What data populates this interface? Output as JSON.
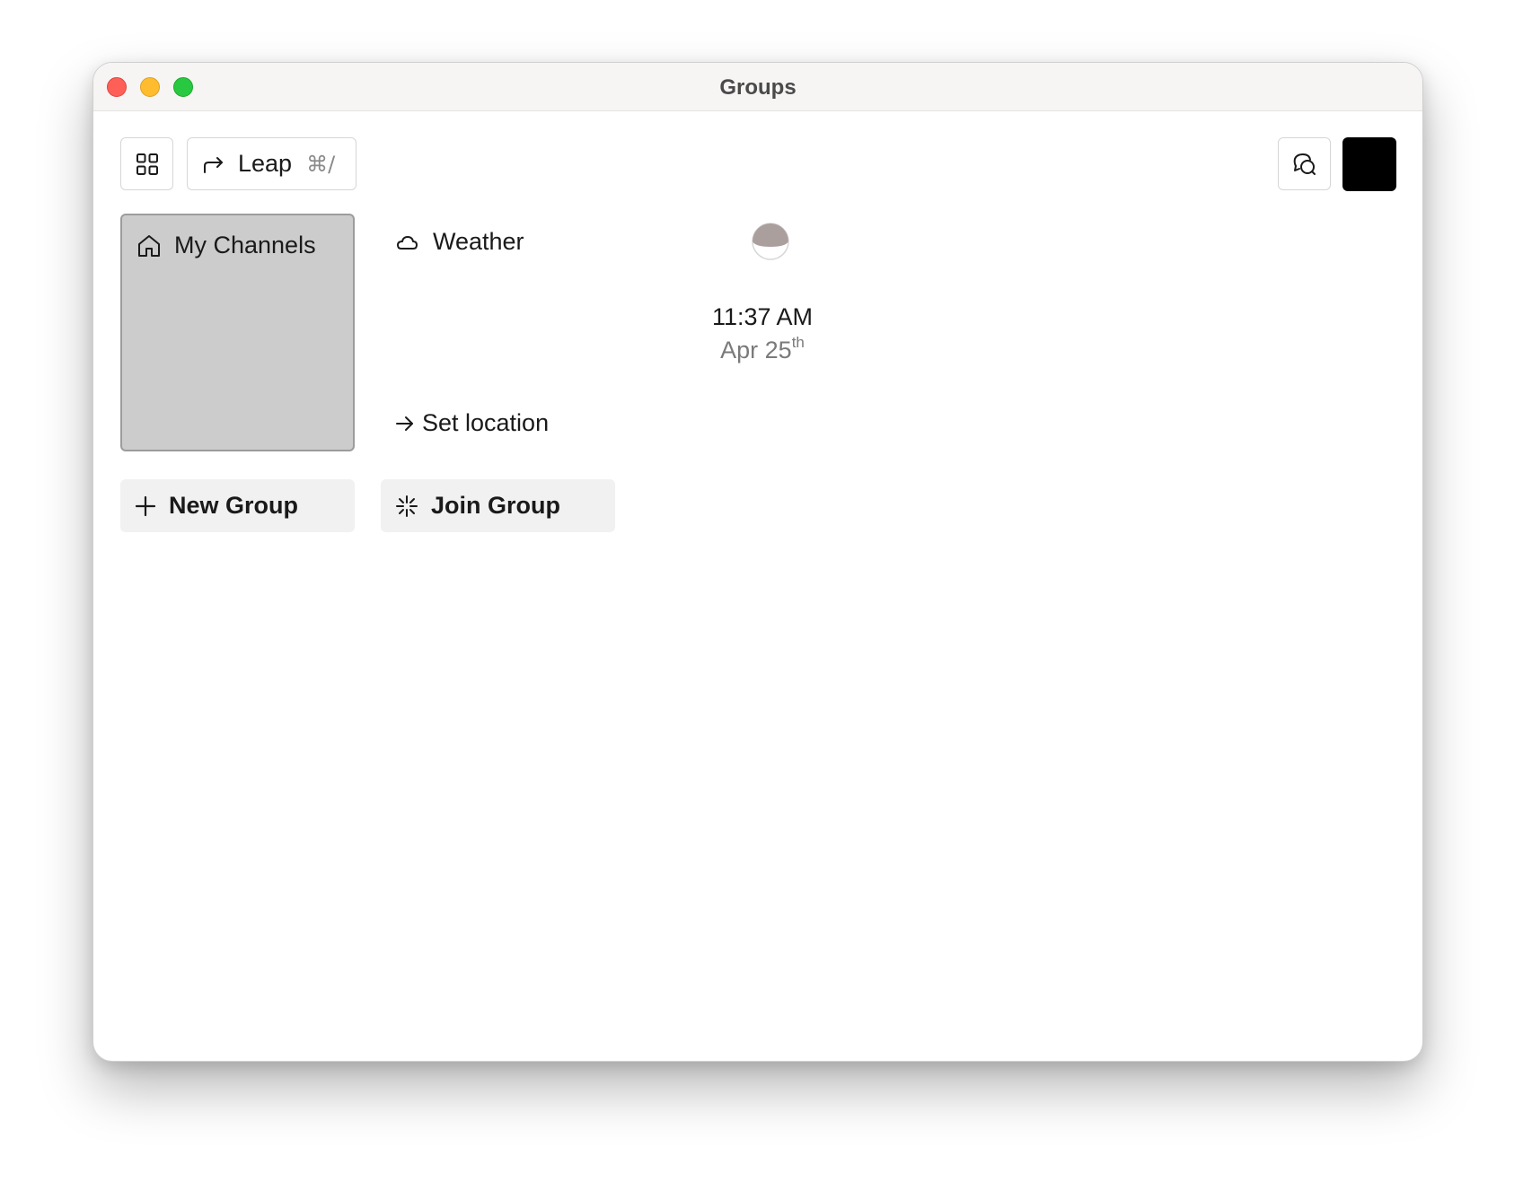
{
  "window": {
    "title": "Groups"
  },
  "toolbar": {
    "apps_icon": "grid-icon",
    "leap_icon": "forward-arrow-icon",
    "leap_label": "Leap",
    "leap_shortcut": "⌘/",
    "messages_icon": "chat-bubbles-icon",
    "avatar_color": "#000000"
  },
  "tiles": {
    "channels": {
      "icon": "home-icon",
      "label": "My Channels",
      "background": "#cccccc"
    },
    "weather": {
      "icon": "cloud-icon",
      "label": "Weather",
      "action_icon": "arrow-right-icon",
      "action_label": "Set location"
    },
    "clock": {
      "icon": "moon-phase-icon",
      "time": "11:37 AM",
      "date": "Apr 25",
      "date_suffix": "th"
    }
  },
  "actions": {
    "new_group": {
      "icon": "plus-icon",
      "label": "New Group"
    },
    "join_group": {
      "icon": "sparkle-icon",
      "label": "Join Group"
    }
  }
}
